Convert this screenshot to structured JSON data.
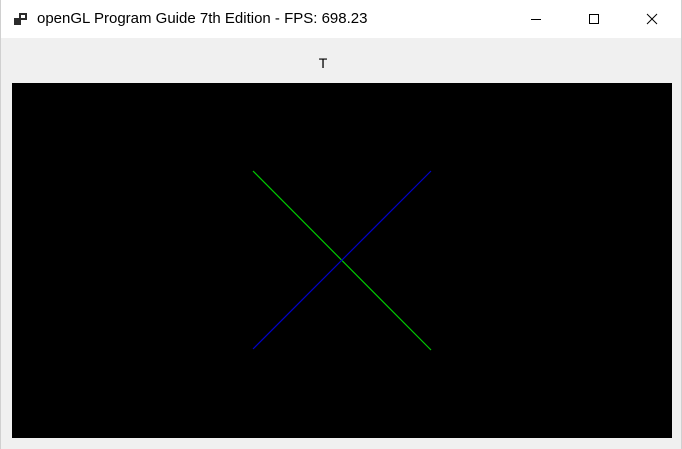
{
  "window": {
    "title": "openGL Program Guide 7th Edition - FPS: 698.23",
    "app_icon": "window-app-icon",
    "controls": {
      "minimize_icon": "minimize-icon",
      "maximize_icon": "maximize-icon",
      "close_icon": "close-icon"
    }
  },
  "menu": {
    "label": "T"
  },
  "scene": {
    "background": "#000000",
    "lines": [
      {
        "name": "green-diagonal-line",
        "color": "#00c800"
      },
      {
        "name": "blue-diagonal-line",
        "color": "#0000c8"
      }
    ]
  }
}
